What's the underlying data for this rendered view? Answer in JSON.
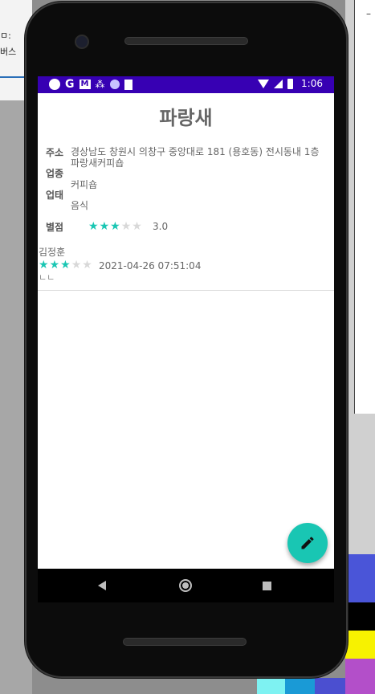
{
  "desktop": {
    "left_text_1": "ㅁ:",
    "left_text_2": "버스",
    "right_dash": "–"
  },
  "status_bar": {
    "time": "1:06",
    "icons": [
      "circle-icon",
      "google-icon",
      "gmail-icon",
      "dots-icon",
      "circle-icon",
      "sd-card-icon",
      "wifi-icon",
      "signal-icon",
      "battery-icon"
    ]
  },
  "place": {
    "name": "파랑새",
    "address_label": "주소",
    "address_value_line1": "경상남도 창원시 의창구 중앙대로 181 (용호동) 전시동내 1층",
    "address_value_line2": "파랑새커피숍",
    "business_type_label": "업종",
    "business_type_value": "커피숍",
    "business_status_label": "업태",
    "business_status_value": "음식",
    "rating_label": "별점",
    "rating_value": "3.0",
    "rating_stars": 3
  },
  "reviews": [
    {
      "author": "김정훈",
      "stars": 3,
      "date": "2021-04-26 07:51:04",
      "text": "ㄴㄴ"
    }
  ],
  "colors": {
    "status_bar": "#3700b3",
    "accent": "#19c6b3"
  }
}
